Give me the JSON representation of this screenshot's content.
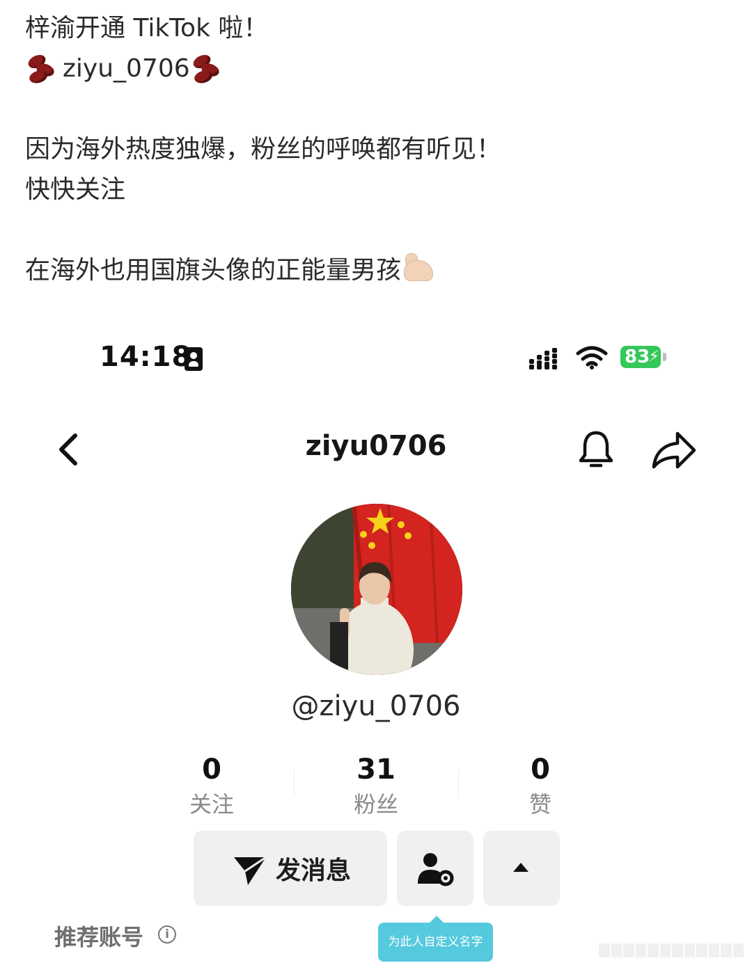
{
  "post": {
    "line1": "梓渝开通 TikTok 啦！",
    "line2": "ziyu_0706",
    "line3": "因为海外热度独爆，粉丝的呼唤都有听见！",
    "line4": "快快关注",
    "line5": "在海外也用国旗头像的正能量男孩"
  },
  "status_bar": {
    "time": "14:18",
    "battery": "83"
  },
  "header": {
    "title": "ziyu0706"
  },
  "profile": {
    "handle": "@ziyu_0706"
  },
  "stats": [
    {
      "value": "0",
      "label": "关注"
    },
    {
      "value": "31",
      "label": "粉丝"
    },
    {
      "value": "0",
      "label": "赞"
    }
  ],
  "actions": {
    "message_label": "发消息"
  },
  "recommend": {
    "label": "推荐账号",
    "info_glyph": "i"
  },
  "tooltip": {
    "text": "为此人自定义名字"
  },
  "colors": {
    "battery": "#34c759",
    "tooltip": "#55c9dd",
    "flag_red": "#d3241f",
    "flag_star": "#f6d21a"
  }
}
